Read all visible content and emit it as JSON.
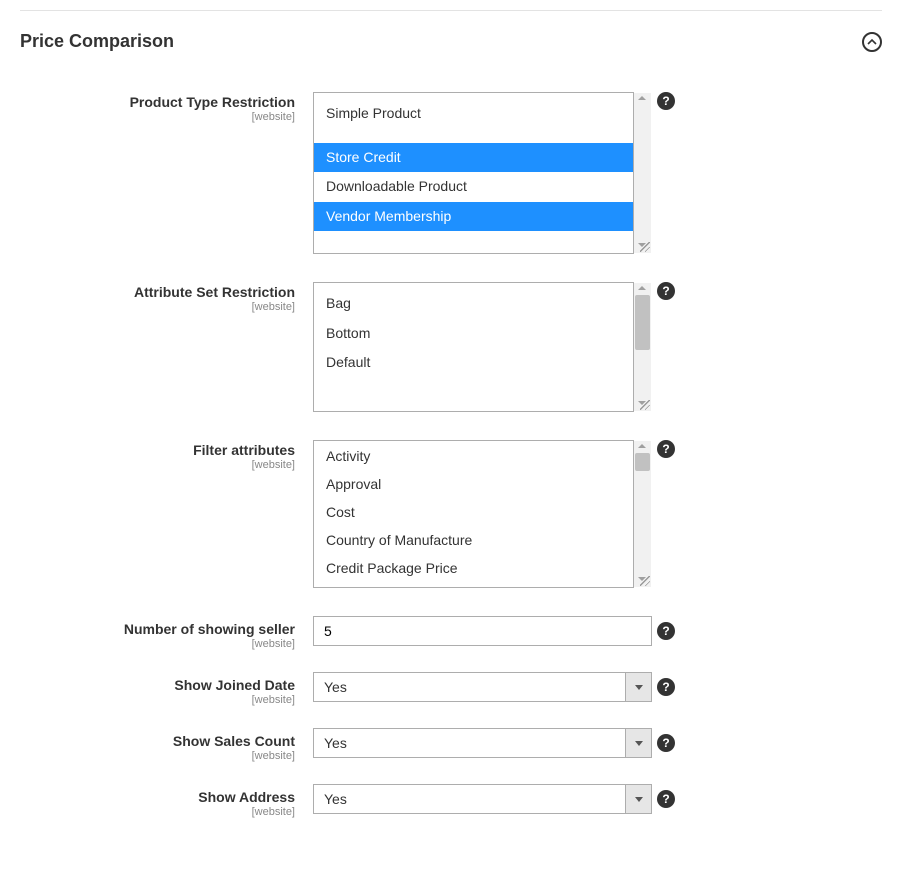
{
  "section": {
    "title": "Price Comparison"
  },
  "scope_label": "[website]",
  "product_type": {
    "label": "Product Type Restriction",
    "options": [
      {
        "label": "Simple Product",
        "selected": false
      },
      {
        "label": "Store Credit",
        "selected": true
      },
      {
        "label": "Downloadable Product",
        "selected": false
      },
      {
        "label": "Vendor Membership",
        "selected": true
      }
    ]
  },
  "attribute_set": {
    "label": "Attribute Set Restriction",
    "options": [
      {
        "label": "Bag",
        "selected": false
      },
      {
        "label": "Bottom",
        "selected": false
      },
      {
        "label": "Default",
        "selected": false
      }
    ]
  },
  "filter_attr": {
    "label": "Filter attributes",
    "options": [
      {
        "label": "Activity",
        "selected": false
      },
      {
        "label": "Approval",
        "selected": false
      },
      {
        "label": "Cost",
        "selected": false
      },
      {
        "label": "Country of Manufacture",
        "selected": false
      },
      {
        "label": "Credit Package Price",
        "selected": false
      }
    ]
  },
  "seller_count": {
    "label": "Number of showing seller",
    "value": "5"
  },
  "joined_date": {
    "label": "Show Joined Date",
    "value": "Yes"
  },
  "sales_count": {
    "label": "Show Sales Count",
    "value": "Yes"
  },
  "address": {
    "label": "Show Address",
    "value": "Yes"
  }
}
